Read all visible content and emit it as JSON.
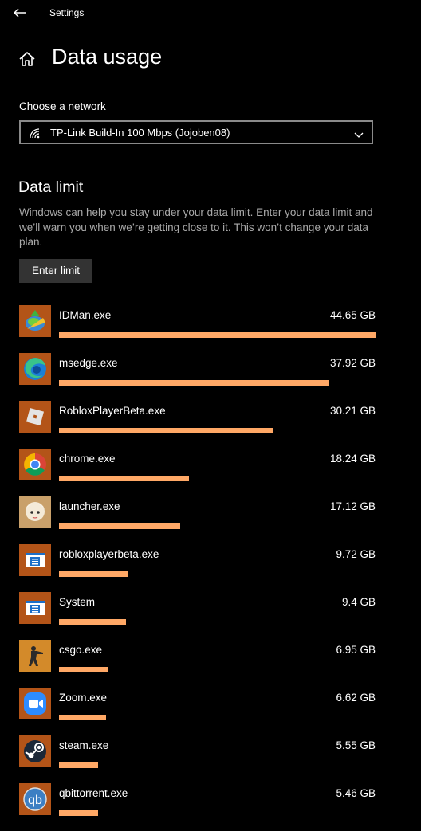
{
  "window": {
    "title": "Settings"
  },
  "page": {
    "title": "Data usage"
  },
  "network": {
    "label": "Choose a network",
    "selected": "TP-Link Build-In 100 Mbps (Jojoben08)",
    "icon": "wifi-icon"
  },
  "data_limit": {
    "heading": "Data limit",
    "description": "Windows can help you stay under your data limit. Enter your data limit and we’ll warn you when we’re getting close to it. This won’t change your data plan.",
    "button_label": "Enter limit"
  },
  "colors": {
    "bar": "#ffa866",
    "icon_bg": "#b35418",
    "background": "#000000"
  },
  "apps": [
    {
      "id": "idman",
      "name": "IDMan.exe",
      "usage": "44.65 GB",
      "fraction": 1.0,
      "icon": "idm-icon"
    },
    {
      "id": "msedge",
      "name": "msedge.exe",
      "usage": "37.92 GB",
      "fraction": 0.849,
      "icon": "edge-icon"
    },
    {
      "id": "roblox",
      "name": "RobloxPlayerBeta.exe",
      "usage": "30.21 GB",
      "fraction": 0.677,
      "icon": "roblox-icon"
    },
    {
      "id": "chrome",
      "name": "chrome.exe",
      "usage": "18.24 GB",
      "fraction": 0.409,
      "icon": "chrome-icon"
    },
    {
      "id": "launcher",
      "name": "launcher.exe",
      "usage": "17.12 GB",
      "fraction": 0.383,
      "icon": "genshin-launcher-icon"
    },
    {
      "id": "robloxlower",
      "name": "robloxplayerbeta.exe",
      "usage": "9.72 GB",
      "fraction": 0.218,
      "icon": "app-window-icon"
    },
    {
      "id": "system",
      "name": "System",
      "usage": "9.4 GB",
      "fraction": 0.211,
      "icon": "app-window-icon"
    },
    {
      "id": "csgo",
      "name": "csgo.exe",
      "usage": "6.95 GB",
      "fraction": 0.156,
      "icon": "csgo-icon"
    },
    {
      "id": "zoom",
      "name": "Zoom.exe",
      "usage": "6.62 GB",
      "fraction": 0.148,
      "icon": "zoom-icon"
    },
    {
      "id": "steam",
      "name": "steam.exe",
      "usage": "5.55 GB",
      "fraction": 0.124,
      "icon": "steam-icon"
    },
    {
      "id": "qbittorrent",
      "name": "qbittorrent.exe",
      "usage": "5.46 GB",
      "fraction": 0.122,
      "icon": "qbittorrent-icon"
    }
  ]
}
